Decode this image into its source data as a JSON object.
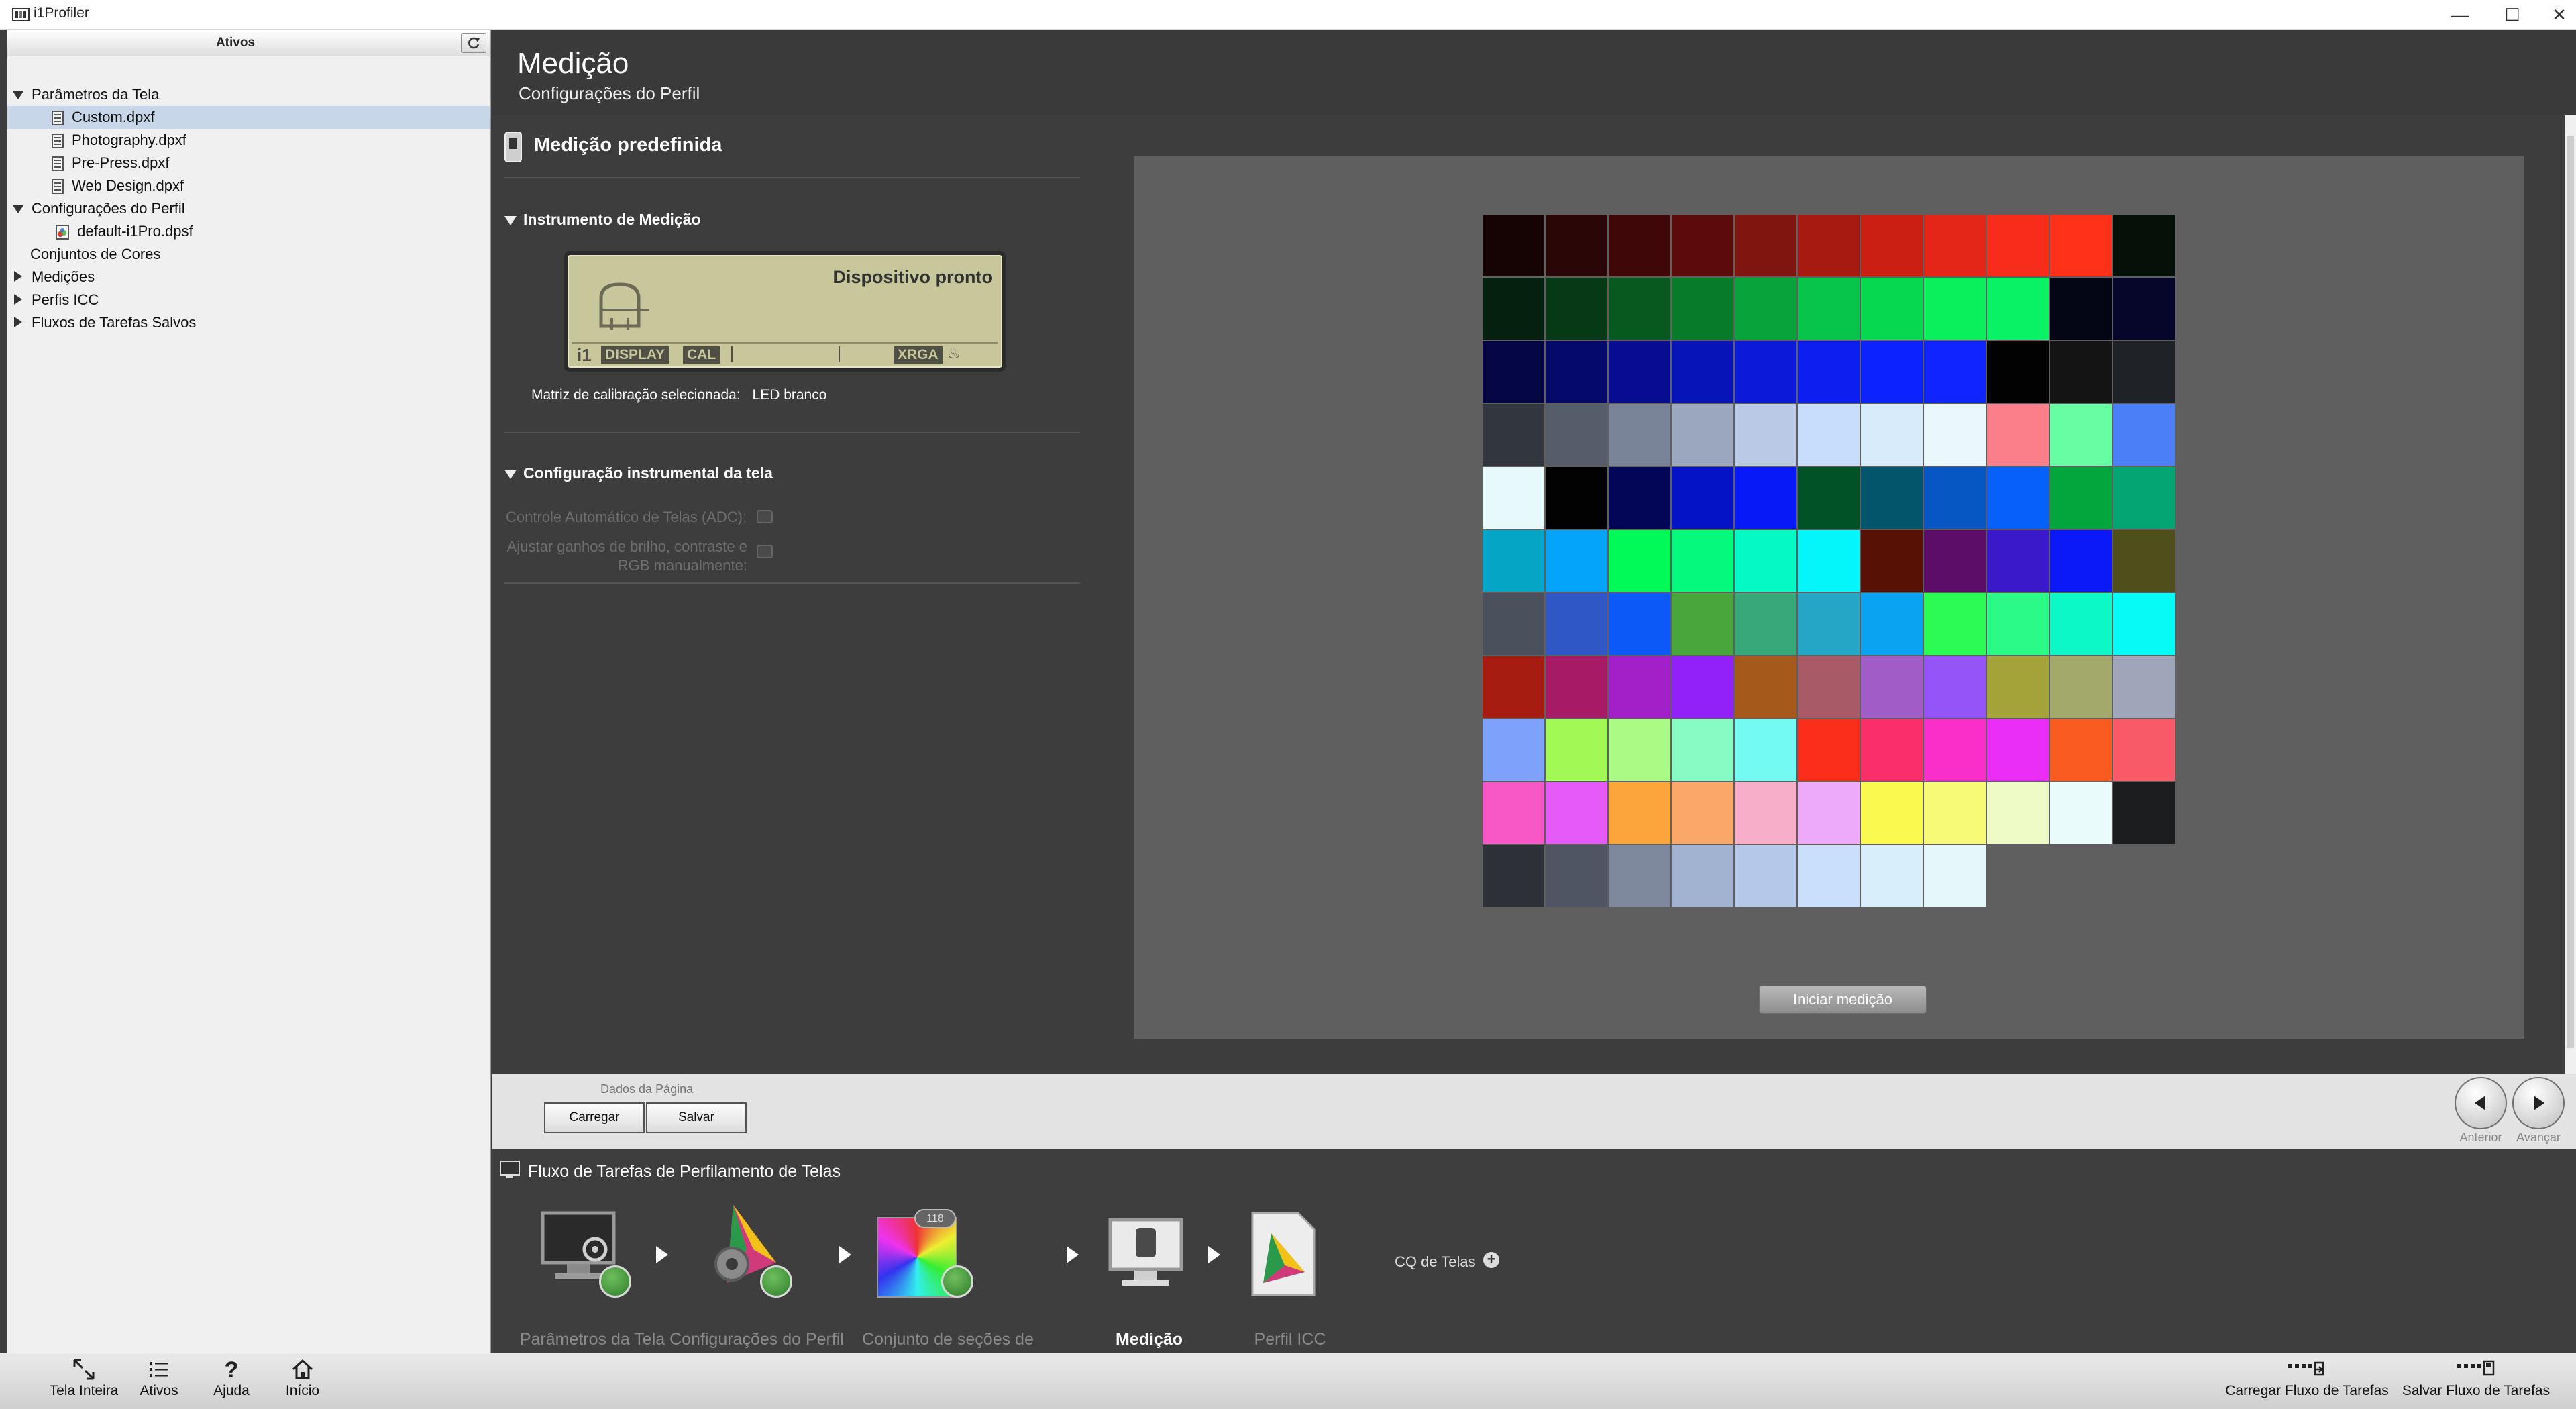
{
  "window": {
    "title": "i1Profiler",
    "controls": [
      "minimize-icon",
      "maximize-icon",
      "close-icon"
    ]
  },
  "sidebar": {
    "header": "Ativos",
    "tree": [
      {
        "label": "Parâmetros da Tela",
        "level": 0,
        "expanded": true
      },
      {
        "label": "Custom.dpxf",
        "level": 1,
        "selected": true,
        "icon": "document-icon"
      },
      {
        "label": "Photography.dpxf",
        "level": 1,
        "icon": "document-icon"
      },
      {
        "label": "Pre-Press.dpxf",
        "level": 1,
        "icon": "document-icon"
      },
      {
        "label": "Web Design.dpxf",
        "level": 1,
        "icon": "document-icon"
      },
      {
        "label": "Configurações do Perfil",
        "level": 0,
        "expanded": true
      },
      {
        "label": "default-i1Pro.dpsf",
        "level": 1,
        "icon": "profile-settings-icon"
      },
      {
        "label": "Conjuntos de Cores",
        "level": 0
      },
      {
        "label": "Medições",
        "level": 0,
        "expanded": false
      },
      {
        "label": "Perfis ICC",
        "level": 0,
        "expanded": false
      },
      {
        "label": "Fluxos de Tarefas Salvos",
        "level": 0,
        "expanded": false
      }
    ]
  },
  "header": {
    "title": "Medição",
    "subtitle": "Configurações do Perfil"
  },
  "settings": {
    "panel_title": "Medição predefinida",
    "instrument_section": "Instrumento de Medição",
    "lcd": {
      "status": "Dispositivo pronto",
      "tags": [
        "DISPLAY",
        "CAL",
        "XRGA"
      ],
      "logo": "i1"
    },
    "matrix_label": "Matriz de calibração selecionada:",
    "matrix_value": "LED branco",
    "display_section": "Configuração instrumental da tela",
    "adc_label": "Controle Automático de Telas (ADC):",
    "manual_label_1": "Ajustar ganhos de brilho, contraste e",
    "manual_label_2": "RGB manualmente:"
  },
  "patches": {
    "colors": [
      "#160404",
      "#2a0606",
      "#3f0707",
      "#5c0b0b",
      "#801510",
      "#a61a12",
      "#cb1f14",
      "#e32618",
      "#f72c1b",
      "#ff3219",
      "#051108",
      "#06200f",
      "#063a16",
      "#07591f",
      "#077b29",
      "#08a33a",
      "#07c44a",
      "#06d84f",
      "#0af05d",
      "#09f266",
      "#040615",
      "#05062a",
      "#050644",
      "#050a6a",
      "#060d90",
      "#0714b7",
      "#0b1ad8",
      "#0d1ff0",
      "#0c22ff",
      "#0f24ff",
      "#020202",
      "#141414",
      "#1f2227",
      "#32373f",
      "#555d6a",
      "#7a8499",
      "#9ba7be",
      "#b9c9e6",
      "#c8dcfb",
      "#d7ebfb",
      "#eaf8fb",
      "#fb7f8a",
      "#67fda3",
      "#4a7ff8",
      "#e8f9fc",
      "#020202",
      "#030656",
      "#0413c6",
      "#0819f7",
      "#025227",
      "#02556a",
      "#0656c4",
      "#0760fa",
      "#03a63d",
      "#03a673",
      "#05a5c6",
      "#04a4fa",
      "#02fa58",
      "#05f97d",
      "#04f9c4",
      "#04f6fa",
      "#581105",
      "#5b0d67",
      "#3a19ca",
      "#0b18f8",
      "#4f4f1b",
      "#4b515c",
      "#2f58c6",
      "#0d59f7",
      "#48a63d",
      "#39a878",
      "#25a6c6",
      "#0aa3f1",
      "#2bfb54",
      "#2cfa86",
      "#0cf9c7",
      "#06fbf6",
      "#a71c11",
      "#a71a65",
      "#a31fc8",
      "#9220f8",
      "#a55a1b",
      "#a95a67",
      "#a15cc7",
      "#9454f8",
      "#a3a339",
      "#a3a96b",
      "#9fa6ba",
      "#7ea2fb",
      "#a2f955",
      "#aafa85",
      "#88fbc5",
      "#72faf3",
      "#fb2d1b",
      "#fa2f6a",
      "#fa2ec8",
      "#ea2ef8",
      "#fa5b20",
      "#f95a67",
      "#f758c5",
      "#e65afa",
      "#fba53b",
      "#fba769",
      "#f7aec8",
      "#eeaafa",
      "#f9f94f",
      "#f7fa76",
      "#eefbc7",
      "#e9fbfb",
      "#1c1d1f",
      "#2d3036",
      "#4f5562",
      "#7e899e",
      "#a2b2d1",
      "#b6c8e9",
      "#c9dffb",
      "#d9eefb",
      "#e6f7fb"
    ]
  },
  "buttons": {
    "start_measurement": "Iniciar medição"
  },
  "page_data": {
    "label": "Dados da Página",
    "load": "Carregar",
    "save": "Salvar",
    "previous": "Anterior",
    "next": "Avançar"
  },
  "workflow": {
    "title": "Fluxo de Tarefas de Perfilamento de Telas",
    "steps": [
      {
        "label": "Parâmetros da Tela",
        "done": true
      },
      {
        "label": "Configurações do Perfil",
        "done": true
      },
      {
        "label": "Conjunto de seções de cores",
        "done": true,
        "badge": "118"
      },
      {
        "label": "Medição",
        "active": true
      },
      {
        "label": "Perfil ICC"
      }
    ],
    "qc_label": "CQ de Telas"
  },
  "toolbar": {
    "full_screen": "Tela Inteira",
    "assets": "Ativos",
    "help": "Ajuda",
    "home": "Início",
    "load_workflow": "Carregar Fluxo de Tarefas",
    "save_workflow": "Salvar Fluxo de Tarefas"
  }
}
